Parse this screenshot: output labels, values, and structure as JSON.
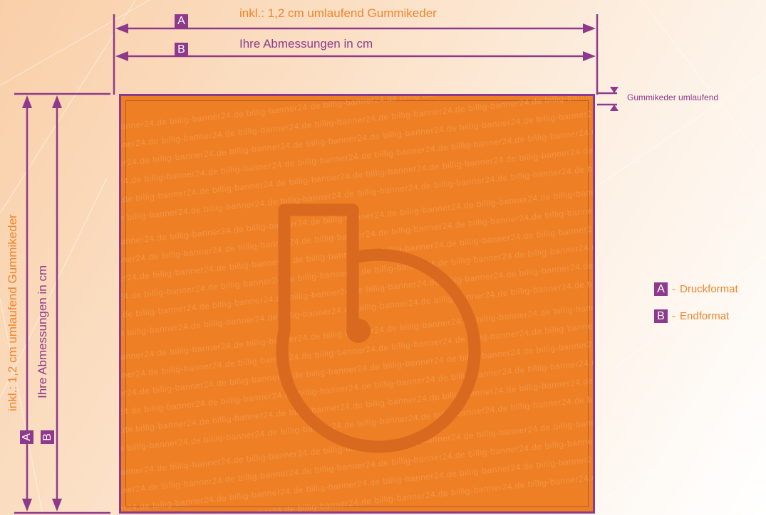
{
  "dimensions": {
    "A_label": "inkl.: 1,2 cm umlaufend Gummikeder",
    "B_label": "Ihre Abmessungen in cm",
    "A_badge": "A",
    "B_badge": "B",
    "side_note": "Gummikeder umlaufend"
  },
  "legend": {
    "items": [
      {
        "badge": "A",
        "separator": "-",
        "text": "Druckformat"
      },
      {
        "badge": "B",
        "separator": "-",
        "text": "Endformat"
      }
    ]
  },
  "banner": {
    "watermark_text": "billig-banner24.de"
  },
  "colors": {
    "accent_purple": "#8e3a8c",
    "banner_orange": "#ee7f24",
    "label_orange": "#f0852a",
    "logo_orange": "#d8691f"
  }
}
